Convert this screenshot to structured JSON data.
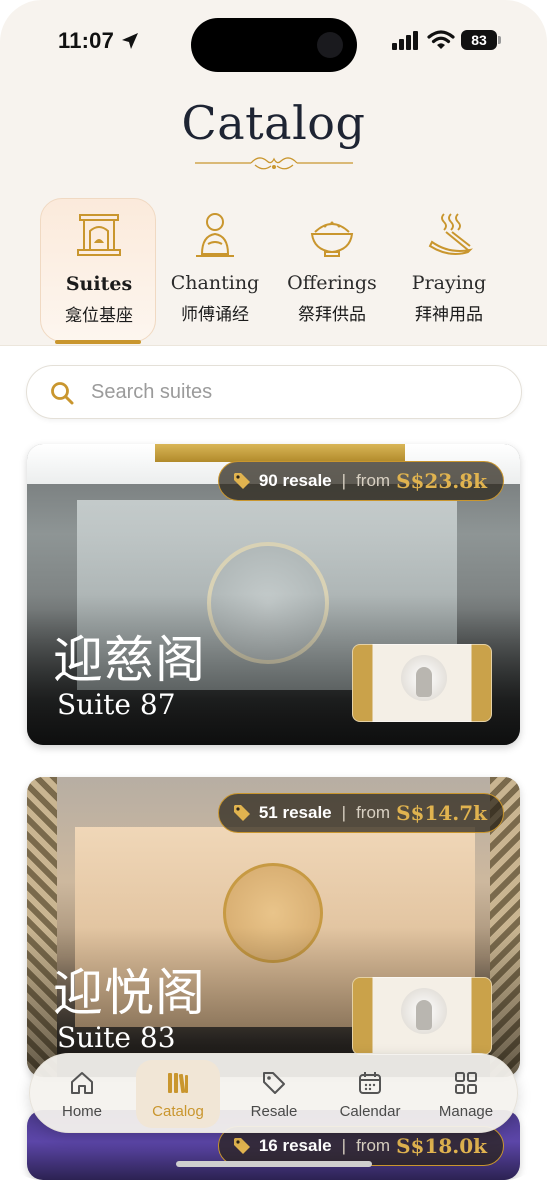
{
  "status": {
    "time": "11:07",
    "battery": "83"
  },
  "header": {
    "title": "Catalog"
  },
  "categories": [
    {
      "en": "Suites",
      "zh": "龛位基座",
      "icon": "shrine-icon",
      "active": true
    },
    {
      "en": "Chanting",
      "zh": "师傅诵经",
      "icon": "monk-icon",
      "active": false
    },
    {
      "en": "Offerings",
      "zh": "祭拜供品",
      "icon": "rice-bowl-icon",
      "active": false
    },
    {
      "en": "Praying",
      "zh": "拜神用品",
      "icon": "incense-icon",
      "active": false
    }
  ],
  "search": {
    "placeholder": "Search suites",
    "value": ""
  },
  "suites": [
    {
      "name_zh": "迎慈阁",
      "suite": "Suite 87",
      "resale": "90 resale",
      "from_label": "from",
      "price": "S$23.8k"
    },
    {
      "name_zh": "迎悦阁",
      "suite": "Suite 83",
      "resale": "51 resale",
      "from_label": "from",
      "price": "S$14.7k"
    },
    {
      "name_zh": "",
      "suite": "",
      "resale": "16 resale",
      "from_label": "from",
      "price": "S$18.0k"
    }
  ],
  "tabbar": [
    {
      "label": "Home",
      "icon": "home-icon",
      "active": false
    },
    {
      "label": "Catalog",
      "icon": "catalog-icon",
      "active": true
    },
    {
      "label": "Resale",
      "icon": "tag-icon",
      "active": false
    },
    {
      "label": "Calendar",
      "icon": "calendar-icon",
      "active": false
    },
    {
      "label": "Manage",
      "icon": "grid-icon",
      "active": false
    }
  ],
  "colors": {
    "accent": "#c9962e",
    "price": "#e0b34f",
    "title": "#1e2433",
    "header_bg": "#f7f3ee"
  }
}
